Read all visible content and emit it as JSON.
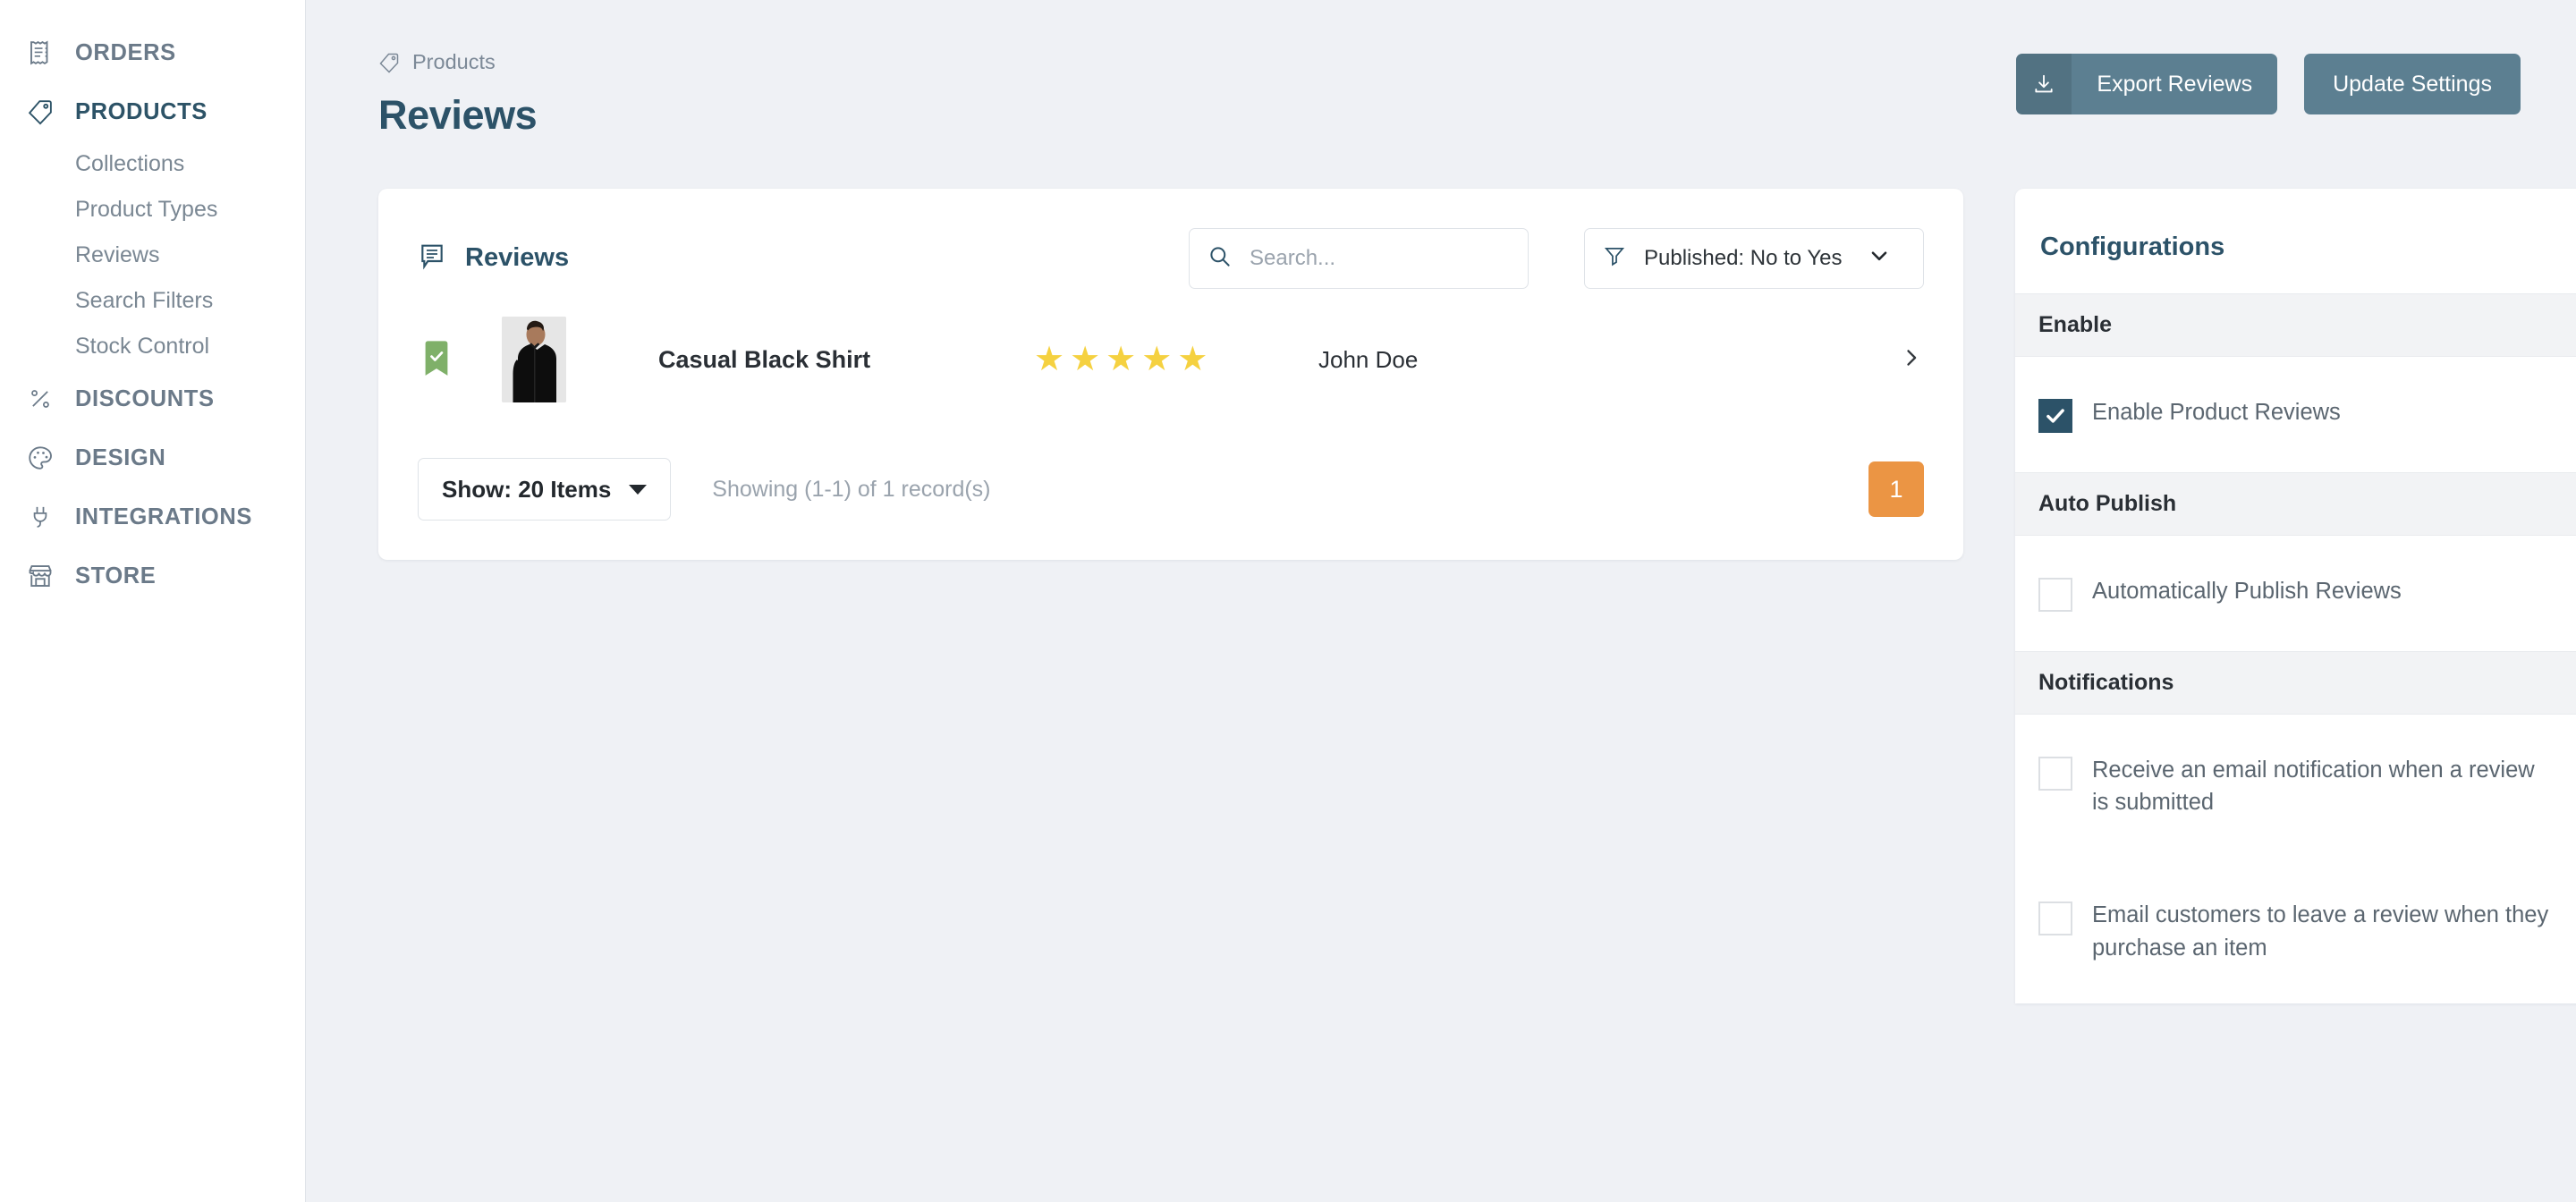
{
  "sidebar": {
    "items": [
      {
        "label": "ORDERS",
        "icon": "receipt-icon",
        "active": false,
        "children": []
      },
      {
        "label": "PRODUCTS",
        "icon": "tag-icon",
        "active": true,
        "children": [
          "Collections",
          "Product Types",
          "Reviews",
          "Search Filters",
          "Stock Control"
        ]
      },
      {
        "label": "DISCOUNTS",
        "icon": "percent-icon",
        "active": false,
        "children": []
      },
      {
        "label": "DESIGN",
        "icon": "palette-icon",
        "active": false,
        "children": []
      },
      {
        "label": "INTEGRATIONS",
        "icon": "plug-icon",
        "active": false,
        "children": []
      },
      {
        "label": "STORE",
        "icon": "storefront-icon",
        "active": false,
        "children": []
      }
    ]
  },
  "header": {
    "breadcrumb": "Products",
    "breadcrumb_icon": "tag-icon",
    "title": "Reviews",
    "export_label": "Export Reviews",
    "export_icon": "download-icon",
    "settings_label": "Update Settings"
  },
  "reviews_card": {
    "title": "Reviews",
    "title_icon": "comment-icon",
    "search": {
      "value": "",
      "placeholder": "Search...",
      "icon": "search-icon"
    },
    "filter": {
      "value": "Published: No to Yes",
      "icon": "funnel-icon",
      "chevron": "chevron-down-icon"
    },
    "rows": [
      {
        "published_badge": "bookmark-check-icon",
        "thumb_alt": "Casual Black Shirt product photo",
        "product": "Casual Black Shirt",
        "rating": 5,
        "author": "John Doe",
        "chevron": "chevron-right-icon"
      }
    ],
    "footer": {
      "show_label": "Show: 20 Items",
      "showing": "Showing (1-1) of 1 record(s)",
      "pages": [
        "1"
      ],
      "active_page": "1"
    }
  },
  "configurations": {
    "title": "Configurations",
    "sections": [
      {
        "heading": "Enable",
        "options": [
          {
            "label": "Enable Product Reviews",
            "checked": true
          }
        ]
      },
      {
        "heading": "Auto Publish",
        "options": [
          {
            "label": "Automatically Publish Reviews",
            "checked": false
          }
        ]
      },
      {
        "heading": "Notifications",
        "options": [
          {
            "label": "Receive an email notification when a review is submitted",
            "checked": false
          },
          {
            "label": "Email customers to leave a review when they purchase an item",
            "checked": false
          }
        ]
      }
    ]
  },
  "colors": {
    "brand_dark": "#2c5268",
    "button": "#5c7f91",
    "accent_orange": "#eb9544",
    "star": "#f5d140",
    "published_green": "#7fb069",
    "page_bg": "#eff1f5"
  }
}
